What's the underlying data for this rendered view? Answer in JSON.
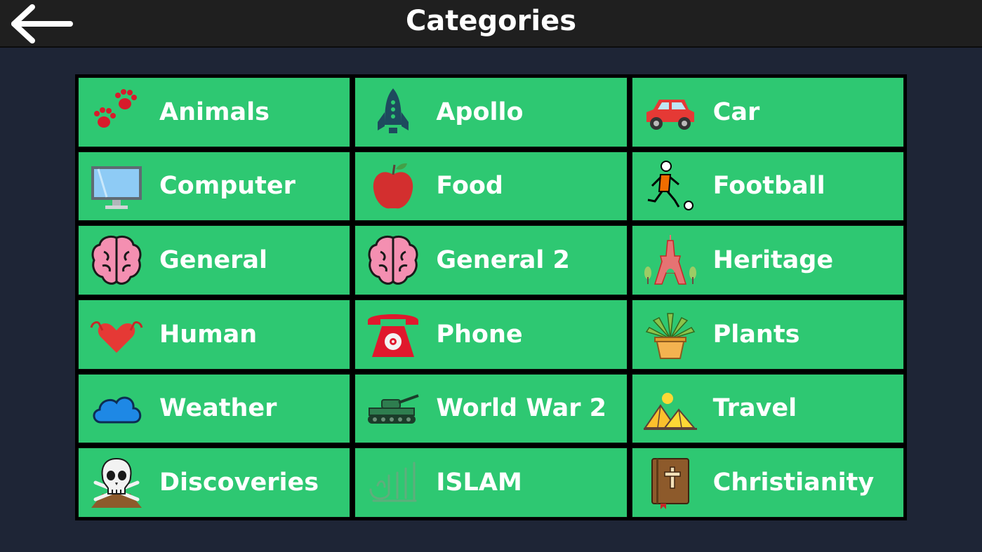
{
  "header": {
    "title": "Categories",
    "back_icon": "back-arrow-icon"
  },
  "categories": [
    {
      "label": "Animals",
      "icon": "paw-prints-icon"
    },
    {
      "label": "Apollo",
      "icon": "rocket-icon"
    },
    {
      "label": "Car",
      "icon": "car-icon"
    },
    {
      "label": "Computer",
      "icon": "monitor-icon"
    },
    {
      "label": "Food",
      "icon": "apple-icon"
    },
    {
      "label": "Football",
      "icon": "football-player-icon"
    },
    {
      "label": "General",
      "icon": "brain-icon"
    },
    {
      "label": "General 2",
      "icon": "brain-icon"
    },
    {
      "label": "Heritage",
      "icon": "eiffel-tower-icon"
    },
    {
      "label": "Human",
      "icon": "heart-biceps-icon"
    },
    {
      "label": "Phone",
      "icon": "telephone-icon"
    },
    {
      "label": "Plants",
      "icon": "potted-plant-icon"
    },
    {
      "label": "Weather",
      "icon": "cloud-icon"
    },
    {
      "label": "World War 2",
      "icon": "tank-icon"
    },
    {
      "label": "Travel",
      "icon": "pyramids-icon"
    },
    {
      "label": "Discoveries",
      "icon": "skull-crossbones-icon"
    },
    {
      "label": "ISLAM",
      "icon": "allah-calligraphy-icon"
    },
    {
      "label": "Christianity",
      "icon": "bible-icon"
    }
  ],
  "colors": {
    "background": "#1e2536",
    "topbar": "#1f1f1f",
    "tile": "#2ec872",
    "grid_border": "#000000",
    "text": "#ffffff"
  }
}
